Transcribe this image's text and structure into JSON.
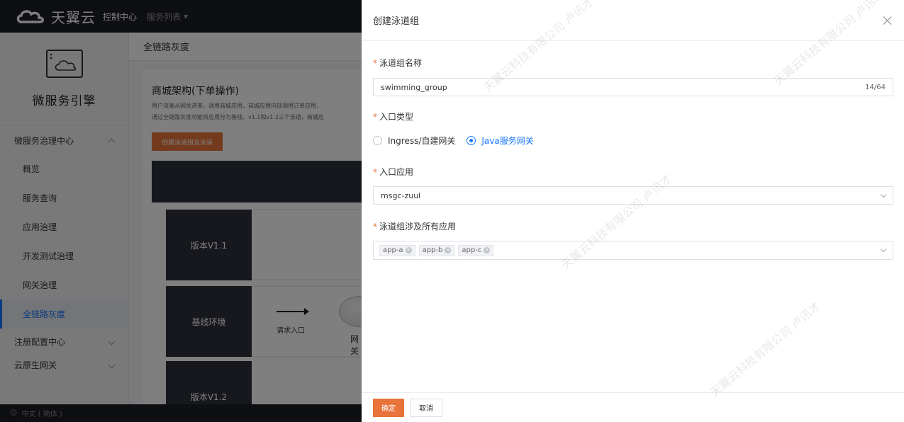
{
  "topbar": {
    "brand": "天翼云",
    "console": "控制中心",
    "service_list": "服务列表"
  },
  "sidebar": {
    "product_title": "微服务引擎",
    "groups": [
      {
        "label": "微服务治理中心",
        "expanded": true
      },
      {
        "label": "注册配置中心",
        "expanded": false
      },
      {
        "label": "云原生网关",
        "expanded": false
      }
    ],
    "items": [
      {
        "label": "概览"
      },
      {
        "label": "服务查询"
      },
      {
        "label": "应用治理"
      },
      {
        "label": "开发测试治理"
      },
      {
        "label": "网关治理"
      },
      {
        "label": "全链路灰度",
        "active": true
      }
    ]
  },
  "footer": {
    "language": "中文 ( 简体 )"
  },
  "main": {
    "breadcrumb": "全链路灰度",
    "heading": "商城架构(下单操作)",
    "desc_line1": "用户流量从网关进来，调用商城应用，商城应用内部调用订单应用，",
    "desc_line2": "通过全链路灰度功能将应用分为基线、v1.1和v1.2三个泳道，商城应",
    "create_button": "创建泳道组及泳道",
    "diagram": {
      "box_top": "版本V1.1",
      "box_mid": "基线环境",
      "box_bottom": "版本V1.2",
      "request_entry": "请求入口",
      "gateway_partial": "网关"
    }
  },
  "drawer": {
    "title": "创建泳道组",
    "fields": {
      "name_label": "泳道组名称",
      "name_value": "swimming_group",
      "name_counter": "14/64",
      "entry_type_label": "入口类型",
      "entry_type_options": [
        "Ingress/自建网关",
        "Java服务网关"
      ],
      "entry_type_selected": "Java服务网关",
      "entry_app_label": "入口应用",
      "entry_app_value": "msgc-zuul",
      "apps_label": "泳道组涉及所有应用",
      "apps_tags": [
        "app-a",
        "app-b",
        "app-c"
      ]
    },
    "ok_button": "确定",
    "cancel_button": "取消"
  },
  "watermark": {
    "company": "天翼云科技有限公司",
    "name": "卢讯才"
  },
  "colors": {
    "accent_orange": "#e8743b",
    "link_blue": "#1677ff",
    "dark_nav": "#1d1f24",
    "diagram_box": "#2e303d"
  }
}
